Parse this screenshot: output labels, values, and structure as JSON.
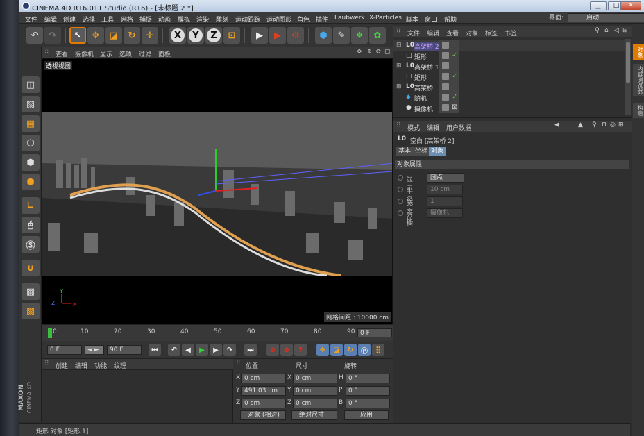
{
  "window": {
    "title": "CINEMA 4D R16.011 Studio (R16) - [未标题 2 *]",
    "buttons": {
      "minimize": "▁",
      "maximize": "□",
      "close": "✕"
    }
  },
  "menu": {
    "items": [
      "文件",
      "编辑",
      "创建",
      "选择",
      "工具",
      "网格",
      "捕捉",
      "动画",
      "模拟",
      "渲染",
      "雕刻",
      "运动跟踪",
      "运动图形",
      "角色",
      "插件",
      "Laubwerk",
      "X-Particles",
      "脚本",
      "窗口",
      "帮助"
    ],
    "layout_label": "界面:",
    "layout_value": "启动"
  },
  "viewport": {
    "menu": [
      "查看",
      "摄像机",
      "显示",
      "选项",
      "过滤",
      "面板"
    ],
    "label": "透视视图",
    "grid_spacing": "网格间距 : 10000 cm",
    "axis": {
      "y": "Y",
      "z": "Z",
      "x": "X"
    }
  },
  "timeline": {
    "ticks": [
      "0",
      "10",
      "20",
      "30",
      "40",
      "50",
      "60",
      "70",
      "80",
      "90"
    ],
    "end_field": "0 F"
  },
  "transport": {
    "current_frame": "0 F",
    "start_field": "◄ ►",
    "end_frame": "90 F"
  },
  "material": {
    "menu": [
      "创建",
      "编辑",
      "功能",
      "纹理"
    ],
    "brand_top": "MAXON",
    "brand_bottom": "CINEMA 4D"
  },
  "coords": {
    "headers": {
      "position": "位置",
      "size": "尺寸",
      "rotation": "旋转"
    },
    "rows": [
      {
        "a": "X",
        "pos": "0 cm",
        "b": "X",
        "size": "0 cm",
        "c": "H",
        "rot": "0 °"
      },
      {
        "a": "Y",
        "pos": "491.03 cm",
        "b": "Y",
        "size": "0 cm",
        "c": "P",
        "rot": "0 °"
      },
      {
        "a": "Z",
        "pos": "0 cm",
        "b": "Z",
        "size": "0 cm",
        "c": "B",
        "rot": "0 °"
      }
    ],
    "mode_select": "对象 (相对)",
    "size_select": "绝对尺寸",
    "apply": "应用"
  },
  "objects": {
    "menu": [
      "文件",
      "编辑",
      "查看",
      "对象",
      "标签",
      "书签"
    ],
    "rows": [
      {
        "name": "高架桥 2",
        "icon": "L0",
        "highlight": true
      },
      {
        "name": "矩形",
        "icon": "□",
        "highlight": false
      },
      {
        "name": "高架桥 1",
        "icon": "L0",
        "highlight": false
      },
      {
        "name": "矩形",
        "icon": "□",
        "highlight": false
      },
      {
        "name": "高架桥",
        "icon": "L0",
        "highlight": false
      },
      {
        "name": "随机",
        "icon": "◆",
        "highlight": false
      },
      {
        "name": "摄像机",
        "icon": "●",
        "highlight": false
      }
    ]
  },
  "attributes": {
    "menu": [
      "模式",
      "编辑",
      "用户数据"
    ],
    "title": "空白 [高架桥 2]",
    "tabs": [
      "基本",
      "坐标",
      "对象"
    ],
    "section": "对象属性",
    "fields": [
      {
        "label": "显示",
        "value": "圆点"
      },
      {
        "label": "半径",
        "value": "10 cm"
      },
      {
        "label": "宽高比",
        "value": "1"
      },
      {
        "label": "方向",
        "value": "摄像机"
      }
    ]
  },
  "right_tabs": [
    "对象",
    "内容浏览器",
    "构造"
  ],
  "status": "矩形 对象 [矩形.1]"
}
